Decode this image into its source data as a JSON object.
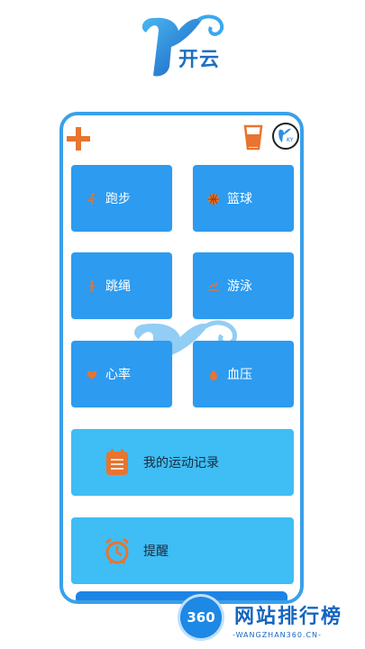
{
  "brand": {
    "name": "开云"
  },
  "tiles": [
    {
      "label": "跑步",
      "icon": "running-icon"
    },
    {
      "label": "篮球",
      "icon": "basketball-icon"
    },
    {
      "label": "跳绳",
      "icon": "jump-rope-icon"
    },
    {
      "label": "游泳",
      "icon": "swimming-icon"
    },
    {
      "label": "心率",
      "icon": "heart-icon"
    },
    {
      "label": "血压",
      "icon": "blood-pressure-icon"
    }
  ],
  "actions": {
    "records_label": "我的运动记录",
    "reminder_label": "提醒"
  },
  "watermark": {
    "title": "网站排行榜",
    "subtitle": "-WANGZHAN360.CN-",
    "badge_text": "360"
  },
  "colors": {
    "tile_blue": "#2c9bf0",
    "wide_blue": "#3fbdf5",
    "accent_orange": "#e8742f",
    "frame_blue": "#3aa0e8"
  }
}
